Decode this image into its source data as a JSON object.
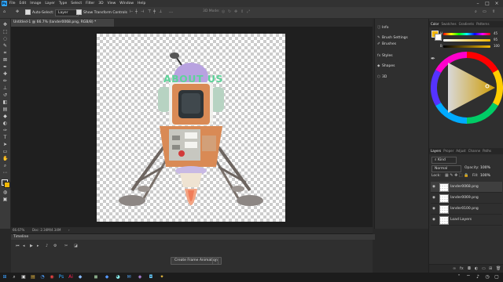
{
  "app": {
    "logo_text": "Ps"
  },
  "menu": [
    "File",
    "Edit",
    "Image",
    "Layer",
    "Type",
    "Select",
    "Filter",
    "3D",
    "View",
    "Window",
    "Help"
  ],
  "options_bar": {
    "auto_select_label": "Auto-Select:",
    "auto_select_target": "Layer",
    "show_transform_label": "Show Transform Controls",
    "mode_label": "3D Mode:"
  },
  "document": {
    "tab_title": "Untitled-1 @ 66.7% (lander0068.png, RGB/8) *",
    "zoom": "66.67%",
    "doc_size": "Doc: 2.34M/4.34M",
    "overlay_text": "ABOUT US"
  },
  "timeline": {
    "title": "Timeline",
    "create_button": "Create Frame Animation"
  },
  "mid_panel": {
    "items": [
      {
        "label": "Info",
        "icon": "info-icon"
      },
      {
        "label": "Brush Settings",
        "icon": "brush-settings-icon"
      },
      {
        "label": "Brushes",
        "icon": "brushes-icon"
      },
      {
        "label": "Styles",
        "icon": "styles-icon"
      },
      {
        "label": "Shapes",
        "icon": "shapes-icon"
      },
      {
        "label": "3D",
        "icon": "cube-icon"
      }
    ]
  },
  "color_panel": {
    "tabs": [
      "Color",
      "Swatches",
      "Gradients",
      "Patterns"
    ],
    "h_label": "H",
    "s_label": "S",
    "b_label": "B",
    "h_value": "45",
    "s_value": "95",
    "b_value": "100",
    "foreground_color": "#f2b705",
    "background_color": "#ffffff"
  },
  "layers_panel": {
    "tabs": [
      "Layers",
      "Proper",
      "Adjust",
      "Channe",
      "Paths"
    ],
    "kind_label": "Kind",
    "blend_mode": "Normal",
    "opacity_label": "Opacity:",
    "opacity_value": "100%",
    "lock_label": "Lock:",
    "fill_label": "Fill:",
    "fill_value": "100%",
    "layers": [
      {
        "name": "lander0068.png",
        "selected": true
      },
      {
        "name": "lander0069.png",
        "selected": false
      },
      {
        "name": "lander0100.png",
        "selected": false
      },
      {
        "name": "Load Layers",
        "selected": false
      }
    ]
  },
  "accent": "#31a8ff"
}
